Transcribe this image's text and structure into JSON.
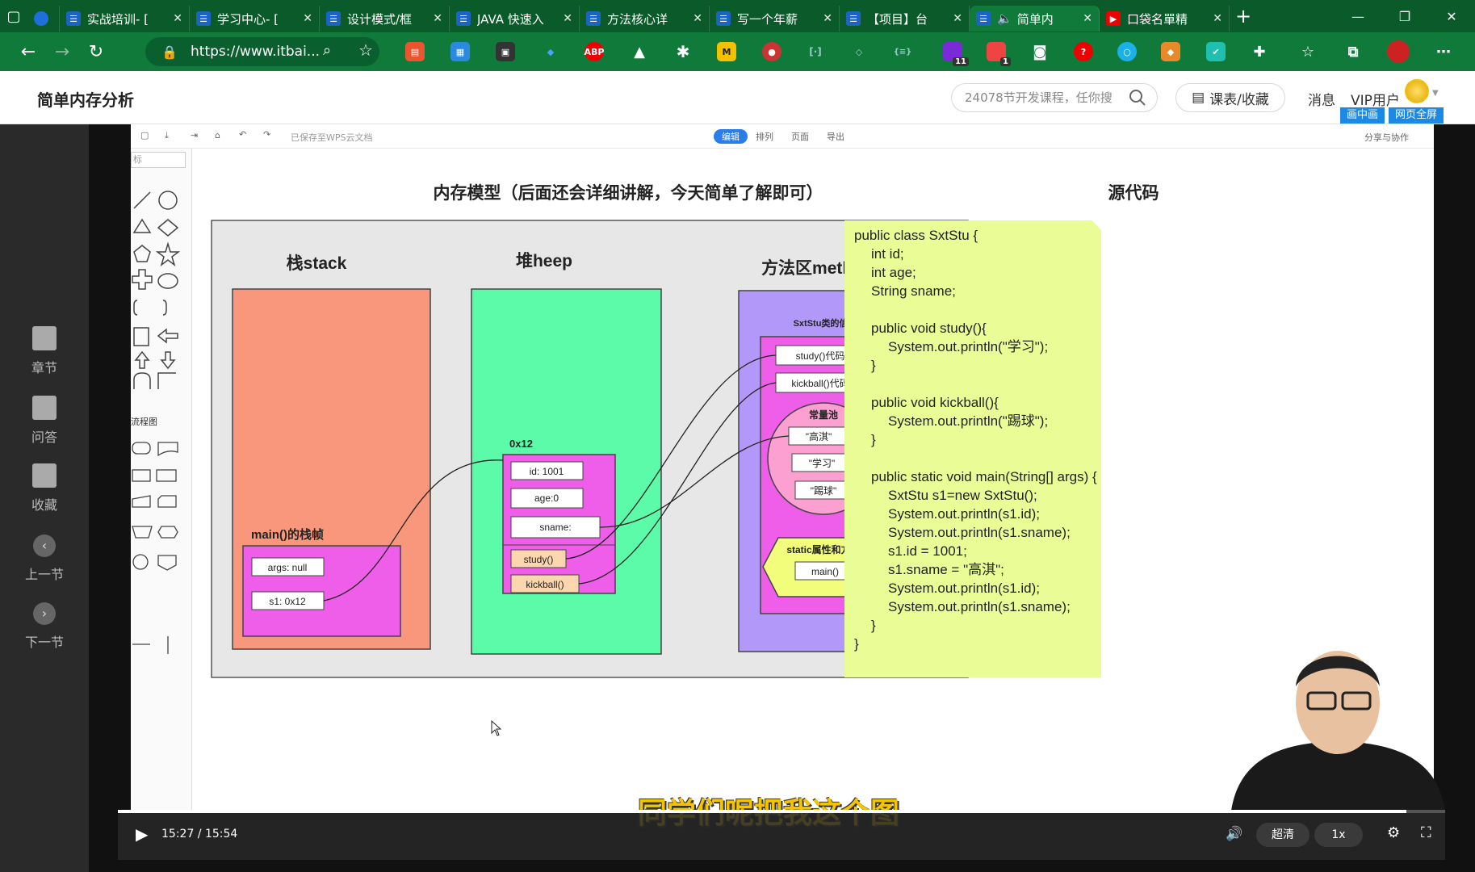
{
  "browser": {
    "tabs": [
      {
        "title": "",
        "icon": "diamond-icon"
      },
      {
        "title": "实战培训- [",
        "icon": "bookmark-icon"
      },
      {
        "title": "学习中心- [",
        "icon": "bookmark-icon"
      },
      {
        "title": "设计模式/框",
        "icon": "bookmark-icon"
      },
      {
        "title": "JAVA 快速入",
        "icon": "bookmark-icon"
      },
      {
        "title": "方法核心详",
        "icon": "bookmark-icon"
      },
      {
        "title": "写一个年薪",
        "icon": "bookmark-icon"
      },
      {
        "title": "【项目】台",
        "icon": "bookmark-icon"
      },
      {
        "title": "简单内",
        "icon": "bookmark-icon"
      },
      {
        "title": "口袋名單精",
        "icon": "youtube-icon"
      }
    ],
    "url": "https://www.itbai...",
    "ext_badges": {
      "a": "11",
      "b": "1"
    },
    "ext_labels": {
      "abp": "ABP",
      "m": "M"
    }
  },
  "site": {
    "title": "简单内存分析",
    "search_placeholder": "24078节开发课程，任你搜",
    "course_btn": "课表/收藏",
    "msg": "消息",
    "vip": "VIP用户",
    "pip": "画中画",
    "fullpage": "网页全屏"
  },
  "sidebar": {
    "items": [
      {
        "label": "章节"
      },
      {
        "label": "问答"
      },
      {
        "label": "收藏"
      },
      {
        "label": "上一节"
      },
      {
        "label": "下一节"
      }
    ]
  },
  "wps": {
    "saved": "已保存至WPS云文档",
    "tabs": [
      "编辑",
      "排列",
      "页面",
      "导出"
    ],
    "share": "分享与协作",
    "panel_search": "标",
    "panel_section": "流程图"
  },
  "diagram": {
    "title_left": "内存模型（后面还会详细讲解，今天简单了解即可）",
    "title_right": "源代码",
    "stack": "栈stack",
    "heap": "堆heep",
    "method": "方法区method area",
    "main_frame": "main()的栈帧",
    "args": "args: null",
    "s1": "s1: 0x12",
    "addr": "0x12",
    "id": "id:  1001",
    "age": "age:0",
    "sname": "sname:",
    "study": "study()",
    "kickball": "kickball()",
    "class_info": "SxtStu类的信息",
    "study_code": "study()代码",
    "kick_code": "kickball()代码",
    "pool": "常量池",
    "c1": "\"高淇\"",
    "c2": "\"学习\"",
    "c3": "\"踢球\"",
    "static": "static属性和方法",
    "main": "main()"
  },
  "code": [
    "public class SxtStu {",
    "   int id;",
    "   int age;",
    "   String sname;",
    "",
    "   public void study(){",
    "      System.out.println(\"学习\");",
    "   }",
    "",
    "   public void kickball(){",
    "      System.out.println(\"踢球\");",
    "   }",
    "",
    "   public static void main(String[] args) {",
    "      SxtStu s1=new SxtStu();",
    "      System.out.println(s1.id);",
    "      System.out.println(s1.sname);",
    "      s1.id = 1001;",
    "      s1.sname = \"高淇\";",
    "      System.out.println(s1.id);",
    "      System.out.println(s1.sname);",
    "   }",
    "}"
  ],
  "player": {
    "time": "15:27 / 15:54",
    "progress": 0.971,
    "quality": "超清",
    "speed": "1x",
    "subtitle": "同学们呢把我这个图"
  }
}
